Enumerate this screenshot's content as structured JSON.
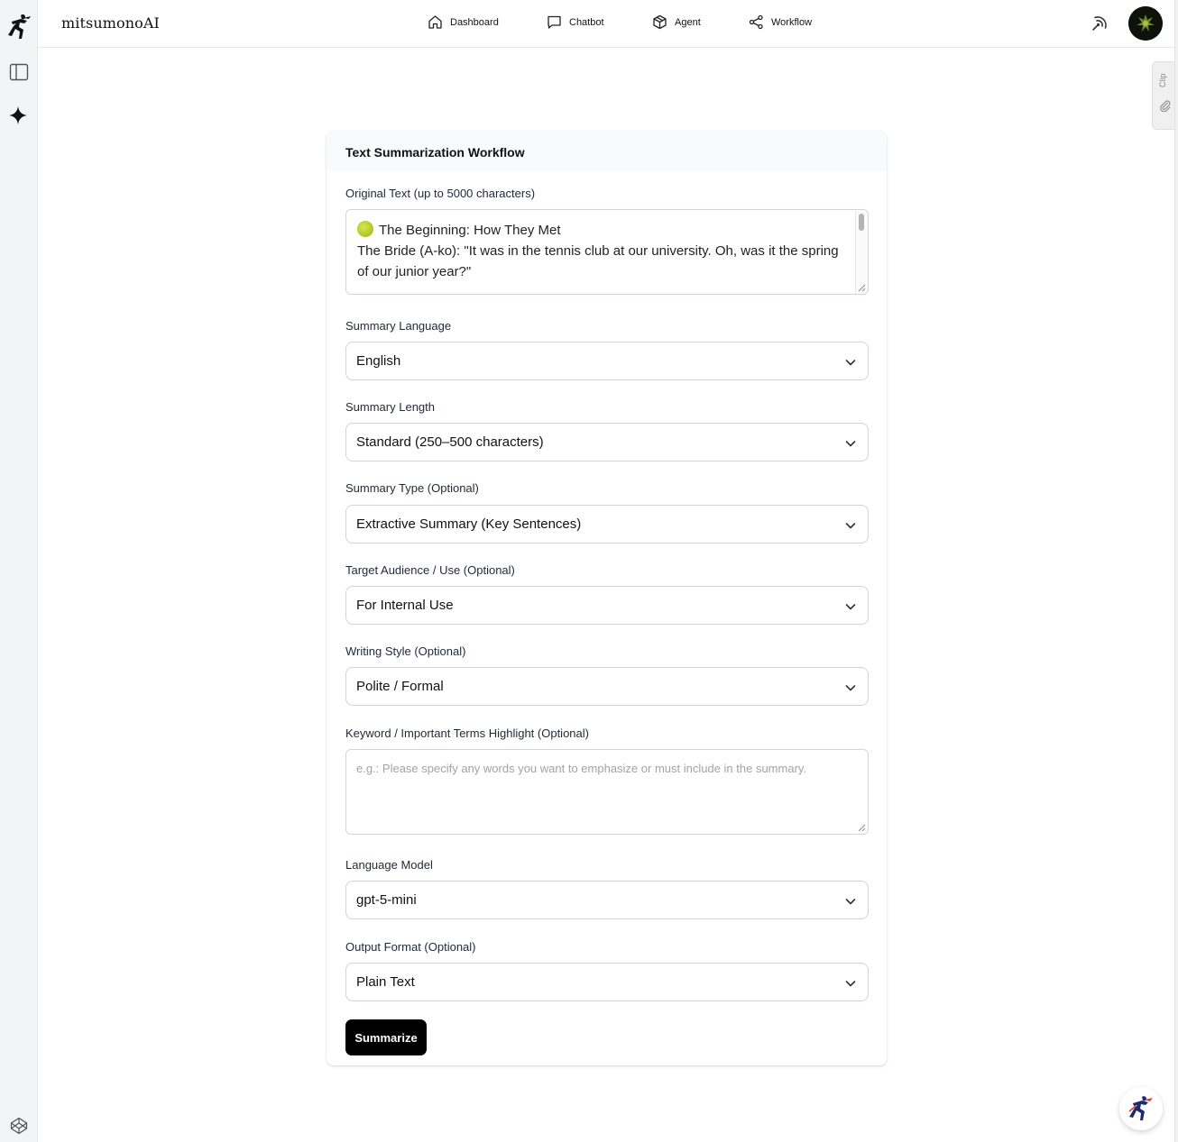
{
  "app": {
    "brand": "mitsumonoAI"
  },
  "nav": {
    "items": [
      {
        "label": "Dashboard",
        "icon": "home-icon"
      },
      {
        "label": "Chatbot",
        "icon": "chat-icon"
      },
      {
        "label": "Agent",
        "icon": "cube-icon"
      },
      {
        "label": "Workflow",
        "icon": "share-icon"
      }
    ]
  },
  "clip_tab": {
    "label": "Clip"
  },
  "form": {
    "title": "Text Summarization Workflow",
    "original_text": {
      "label": "Original Text (up to 5000 characters)",
      "line1": "The Beginning: How They Met",
      "line2": "The Bride (A-ko): \"It was in the tennis club at our university. Oh, was it the spring of our junior year?\""
    },
    "summary_language": {
      "label": "Summary Language",
      "value": "English"
    },
    "summary_length": {
      "label": "Summary Length",
      "value": "Standard (250–500 characters)"
    },
    "summary_type": {
      "label": "Summary Type (Optional)",
      "value": "Extractive Summary (Key Sentences)"
    },
    "target_audience": {
      "label": "Target Audience / Use (Optional)",
      "value": "For Internal Use"
    },
    "writing_style": {
      "label": "Writing Style (Optional)",
      "value": "Polite / Formal"
    },
    "keywords": {
      "label": "Keyword / Important Terms Highlight (Optional)",
      "placeholder": "e.g.: Please specify any words you want to emphasize or must include in the summary."
    },
    "language_model": {
      "label": "Language Model",
      "value": "gpt-5-mini"
    },
    "output_format": {
      "label": "Output Format (Optional)",
      "value": "Plain Text"
    },
    "submit_label": "Summarize"
  },
  "colors": {
    "primary_button": "#000000",
    "card_header": "#f8fafc",
    "rail": "#f3f4f6",
    "tennis_ball": "#b5cc2a"
  }
}
